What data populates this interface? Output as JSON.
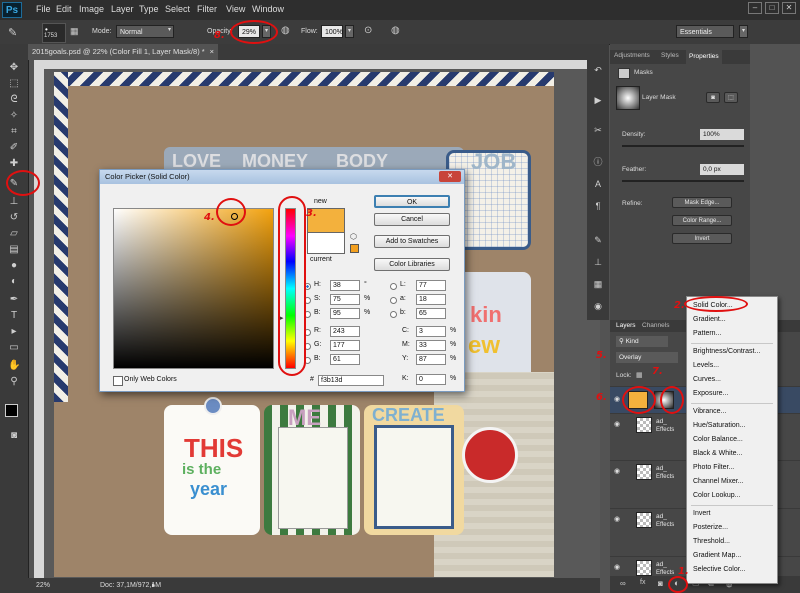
{
  "app": {
    "logo": "Ps"
  },
  "menubar": {
    "items": [
      "File",
      "Edit",
      "Image",
      "Layer",
      "Type",
      "Select",
      "Filter",
      "View",
      "Window"
    ]
  },
  "window_controls": {
    "minimize": "–",
    "maximize": "□",
    "close": "✕"
  },
  "options": {
    "brush_size": "1753",
    "mode_label": "Mode:",
    "mode_value": "Normal",
    "opacity_label": "Opacity:",
    "opacity_value": "29%",
    "flow_label": "Flow:",
    "flow_value": "100%",
    "workspace": "Essentials"
  },
  "document": {
    "tab_title": "2015goals.psd @ 22% (Color Fill 1, Layer Mask/8) *",
    "close": "×"
  },
  "status": {
    "zoom": "22%",
    "doc_info": "Doc: 37,1M/972,1M"
  },
  "canvas_art": {
    "words": [
      "LOVE",
      "MONEY",
      "BODY",
      "JOB",
      "ME",
      "CREATE",
      "THIS",
      "is the",
      "year",
      "kin",
      "ew"
    ]
  },
  "properties": {
    "tabs": [
      "Adjustments",
      "Styles",
      "Properties"
    ],
    "section": "Masks",
    "mask_title": "Layer Mask",
    "density_label": "Density:",
    "density_value": "100%",
    "feather_label": "Feather:",
    "feather_value": "0,0 px",
    "refine_label": "Refine:",
    "buttons": [
      "Mask Edge...",
      "Color Range...",
      "Invert"
    ]
  },
  "layers": {
    "tabs": [
      "Layers",
      "Channels"
    ],
    "kind": "Kind",
    "blend": "Overlay",
    "lock_label": "Lock:",
    "rows": [
      {
        "name": "ad_",
        "sub": "Effects"
      },
      {
        "name": "ad_",
        "sub": "Effects"
      },
      {
        "name": "ad_",
        "sub": "Effects"
      },
      {
        "name": "ad_",
        "sub": "Effects"
      }
    ]
  },
  "adjustment_menu": {
    "groups": [
      [
        "Solid Color...",
        "Gradient...",
        "Pattern..."
      ],
      [
        "Brightness/Contrast...",
        "Levels...",
        "Curves...",
        "Exposure..."
      ],
      [
        "Vibrance...",
        "Hue/Saturation...",
        "Color Balance...",
        "Black & White...",
        "Photo Filter...",
        "Channel Mixer...",
        "Color Lookup..."
      ],
      [
        "Invert",
        "Posterize...",
        "Threshold...",
        "Gradient Map...",
        "Selective Color..."
      ]
    ]
  },
  "color_picker": {
    "title": "Color Picker (Solid Color)",
    "close": "✕",
    "new_label": "new",
    "current_label": "current",
    "buttons": [
      "OK",
      "Cancel",
      "Add to Swatches",
      "Color Libraries"
    ],
    "only_web": "Only Web Colors",
    "fields": {
      "H": "38",
      "S": "75",
      "B": "95",
      "R": "243",
      "G": "177",
      "Bb": "61",
      "L": "77",
      "a": "18",
      "b": "65",
      "C": "3",
      "M": "33",
      "Y": "87",
      "K": "0"
    },
    "units": {
      "deg": "°",
      "pct": "%"
    },
    "hex_label": "#",
    "hex_value": "f3b13d",
    "new_color": "#f3b13d",
    "current_color": "#ffffff"
  },
  "annotations": [
    "1.",
    "2.",
    "3.",
    "4.",
    "5.",
    "6.",
    "7.",
    "8."
  ],
  "colors": {
    "accent_red": "#e01010",
    "selected_color": "#f3b13d"
  }
}
